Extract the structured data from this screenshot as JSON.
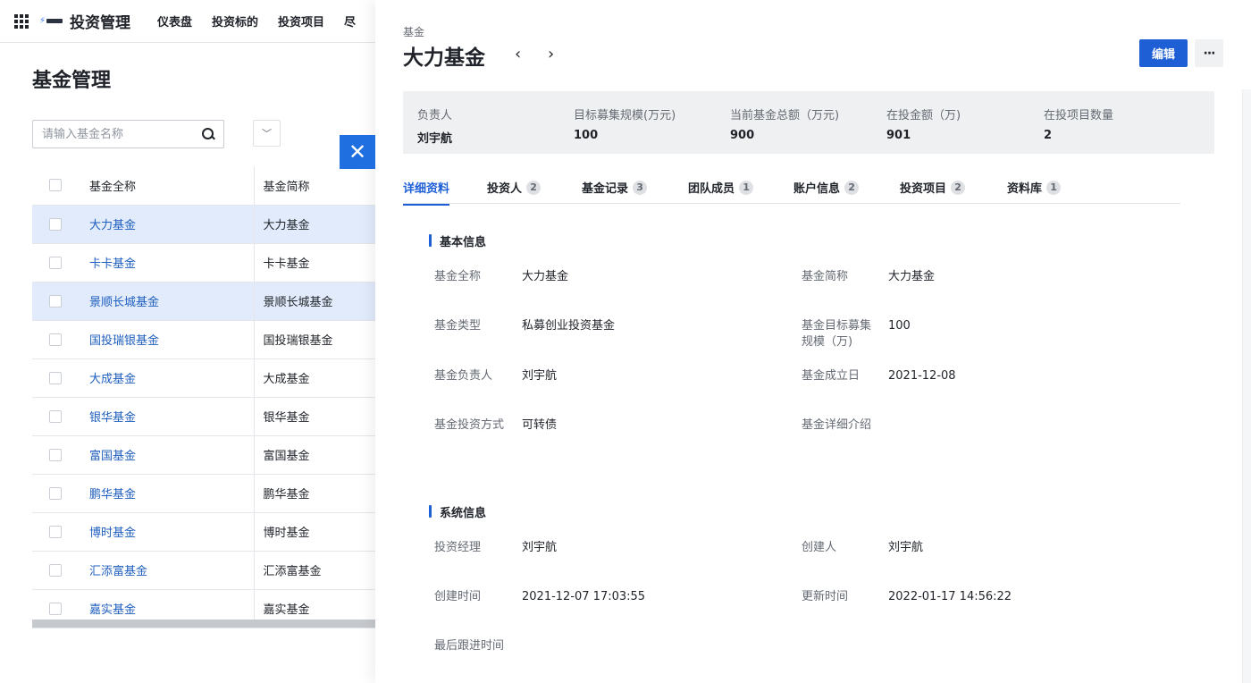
{
  "app": {
    "title": "投资管理",
    "nav": [
      "仪表盘",
      "投资标的",
      "投资项目",
      "尽"
    ]
  },
  "list": {
    "page_title": "基金管理",
    "search_placeholder": "请输入基金名称",
    "columns": [
      "基金全称",
      "基金简称"
    ],
    "rows": [
      {
        "full": "大力基金",
        "short": "大力基金",
        "selected": true
      },
      {
        "full": "卡卡基金",
        "short": "卡卡基金",
        "selected": false
      },
      {
        "full": "景顺长城基金",
        "short": "景顺长城基金",
        "selected": true
      },
      {
        "full": "国投瑞银基金",
        "short": "国投瑞银基金",
        "selected": false
      },
      {
        "full": "大成基金",
        "short": "大成基金",
        "selected": false
      },
      {
        "full": "银华基金",
        "short": "银华基金",
        "selected": false
      },
      {
        "full": "富国基金",
        "short": "富国基金",
        "selected": false
      },
      {
        "full": "鹏华基金",
        "short": "鹏华基金",
        "selected": false
      },
      {
        "full": "博时基金",
        "short": "博时基金",
        "selected": false
      },
      {
        "full": "汇添富基金",
        "short": "汇添富基金",
        "selected": false
      },
      {
        "full": "嘉实基金",
        "short": "嘉实基金",
        "selected": false
      }
    ]
  },
  "drawer": {
    "breadcrumb": "基金",
    "title": "大力基金",
    "prev": "‹",
    "next": "›",
    "edit_label": "编辑",
    "more_label": "···",
    "close_label": "✕",
    "summary": [
      {
        "label": "负责人",
        "value": "刘宇航"
      },
      {
        "label": "目标募集规模(万元)",
        "value": "100"
      },
      {
        "label": "当前基金总额（万元)",
        "value": "900"
      },
      {
        "label": "在投金额（万)",
        "value": "901"
      },
      {
        "label": "在投项目数量",
        "value": "2"
      }
    ],
    "tabs": [
      {
        "label": "详细资料",
        "count": ""
      },
      {
        "label": "投资人",
        "count": "2"
      },
      {
        "label": "基金记录",
        "count": "3"
      },
      {
        "label": "团队成员",
        "count": "1"
      },
      {
        "label": "账户信息",
        "count": "2"
      },
      {
        "label": "投资项目",
        "count": "2"
      },
      {
        "label": "资料库",
        "count": "1"
      }
    ],
    "basic_title": "基本信息",
    "basic": {
      "full_name_label": "基金全称",
      "full_name": "大力基金",
      "short_name_label": "基金简称",
      "short_name": "大力基金",
      "type_label": "基金类型",
      "type": "私募创业投资基金",
      "target_label_1": "基金目标募集",
      "target_label_2": "规模（万)",
      "target": "100",
      "owner_label": "基金负责人",
      "owner": "刘宇航",
      "founded_label": "基金成立日",
      "founded": "2021-12-08",
      "method_label": "基金投资方式",
      "method": "可转债",
      "intro_label": "基金详细介绍",
      "intro": ""
    },
    "system_title": "系统信息",
    "system": {
      "manager_label": "投资经理",
      "manager": "刘宇航",
      "creator_label": "创建人",
      "creator": "刘宇航",
      "created_label": "创建时间",
      "created": "2021-12-07 17:03:55",
      "updated_label": "更新时间",
      "updated": "2022-01-17 14:56:22",
      "followup_label": "最后跟进时间",
      "followup": ""
    }
  }
}
